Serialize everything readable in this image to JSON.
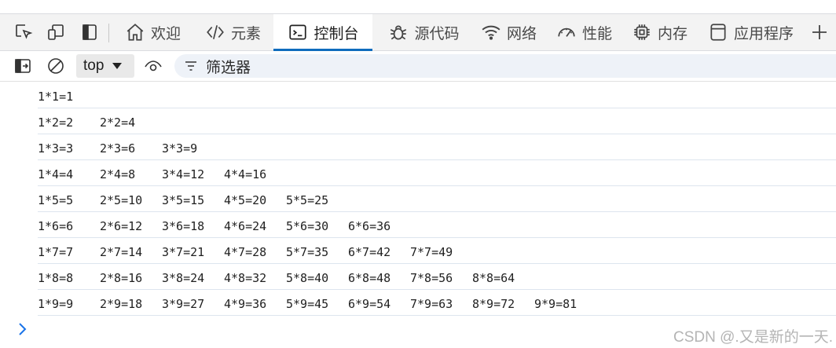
{
  "toolbar": {
    "icons": [
      "inspect-icon",
      "device-emulation-icon",
      "dock-icon"
    ],
    "tabs": [
      {
        "label": "欢迎",
        "icon": "home-icon",
        "active": false
      },
      {
        "label": "元素",
        "icon": "code-icon",
        "active": false
      },
      {
        "label": "控制台",
        "icon": "console-icon",
        "active": true
      },
      {
        "label": "源代码",
        "icon": "bug-icon",
        "active": false
      },
      {
        "label": "网络",
        "icon": "wifi-icon",
        "active": false
      },
      {
        "label": "性能",
        "icon": "gauge-icon",
        "active": false
      },
      {
        "label": "内存",
        "icon": "chip-icon",
        "active": false
      },
      {
        "label": "应用程序",
        "icon": "app-window-icon",
        "active": false
      }
    ],
    "more_icon": "plus-icon",
    "accent_color": "#0f6cbd"
  },
  "filterbar": {
    "context": "top",
    "filter_placeholder": "筛选器"
  },
  "console": {
    "rows": [
      [
        "1*1=1"
      ],
      [
        "1*2=2",
        "2*2=4"
      ],
      [
        "1*3=3",
        "2*3=6",
        "3*3=9"
      ],
      [
        "1*4=4",
        "2*4=8",
        "3*4=12",
        "4*4=16"
      ],
      [
        "1*5=5",
        "2*5=10",
        "3*5=15",
        "4*5=20",
        "5*5=25"
      ],
      [
        "1*6=6",
        "2*6=12",
        "3*6=18",
        "4*6=24",
        "5*6=30",
        "6*6=36"
      ],
      [
        "1*7=7",
        "2*7=14",
        "3*7=21",
        "4*7=28",
        "5*7=35",
        "6*7=42",
        "7*7=49"
      ],
      [
        "1*8=8",
        "2*8=16",
        "3*8=24",
        "4*8=32",
        "5*8=40",
        "6*8=48",
        "7*8=56",
        "8*8=64"
      ],
      [
        "1*9=9",
        "2*9=18",
        "3*9=27",
        "4*9=36",
        "5*9=45",
        "6*9=54",
        "7*9=63",
        "8*9=72",
        "9*9=81"
      ]
    ]
  },
  "watermark": "CSDN @.又是新的一天."
}
